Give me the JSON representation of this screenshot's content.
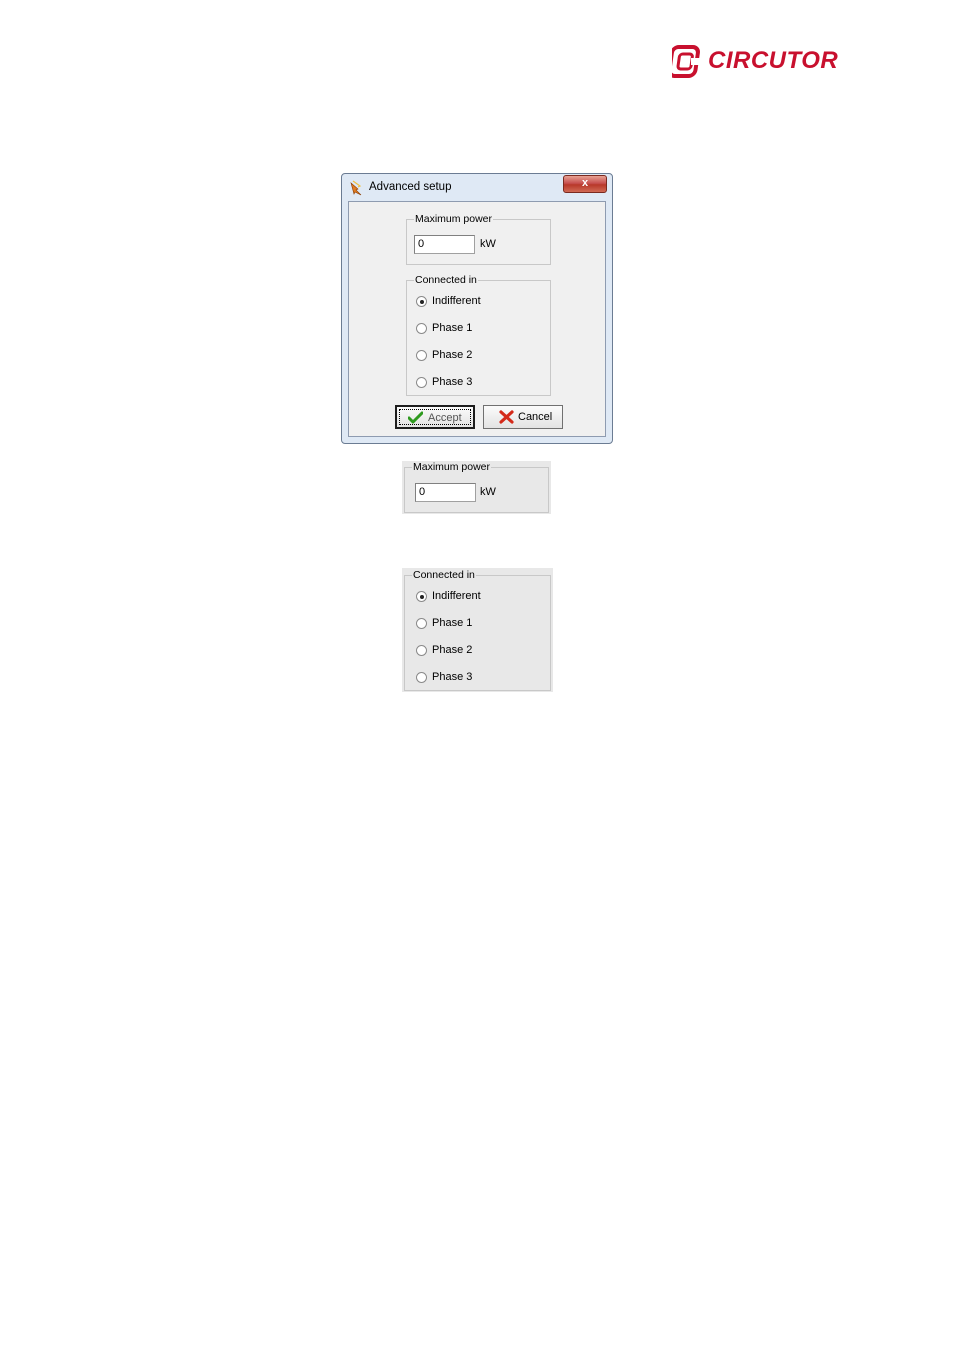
{
  "logo": {
    "text": "CIRCUTOR",
    "color": "#c8102e"
  },
  "dialog": {
    "title": "Advanced setup",
    "close_label": "x",
    "max_power": {
      "group_label": "Maximum power",
      "value": "0",
      "unit": "kW"
    },
    "connected_in": {
      "group_label": "Connected in",
      "options": [
        {
          "label": "Indifferent",
          "checked": true
        },
        {
          "label": "Phase 1",
          "checked": false
        },
        {
          "label": "Phase 2",
          "checked": false
        },
        {
          "label": "Phase 3",
          "checked": false
        }
      ]
    },
    "buttons": {
      "accept_label": "Accept",
      "cancel_label": "Cancel"
    }
  },
  "zoom_max_power": {
    "group_label": "Maximum power",
    "value": "0",
    "unit": "kW"
  },
  "zoom_connected_in": {
    "group_label": "Connected in",
    "options": [
      {
        "label": "Indifferent",
        "checked": true
      },
      {
        "label": "Phase 1",
        "checked": false
      },
      {
        "label": "Phase 2",
        "checked": false
      },
      {
        "label": "Phase 3",
        "checked": false
      }
    ]
  }
}
